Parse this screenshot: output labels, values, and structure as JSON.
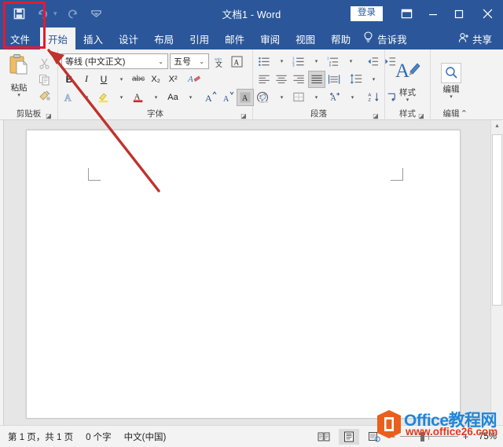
{
  "titlebar": {
    "quick_access": [
      {
        "name": "save-icon",
        "label": "保存"
      },
      {
        "name": "undo-icon",
        "label": "撤消"
      },
      {
        "name": "redo-icon",
        "label": "恢复"
      },
      {
        "name": "customize-qat-icon",
        "label": "自定义快速访问工具栏"
      }
    ],
    "document_title": "文档1  -  Word",
    "signin_label": "登录",
    "ribbon_display_label": "功能区显示选项",
    "minimize_label": "最小化",
    "maximize_label": "最大化",
    "close_label": "关闭"
  },
  "tabs": [
    {
      "label": "文件",
      "active": false,
      "file": true
    },
    {
      "label": "开始",
      "active": true
    },
    {
      "label": "插入",
      "active": false
    },
    {
      "label": "设计",
      "active": false
    },
    {
      "label": "布局",
      "active": false
    },
    {
      "label": "引用",
      "active": false
    },
    {
      "label": "邮件",
      "active": false
    },
    {
      "label": "审阅",
      "active": false
    },
    {
      "label": "视图",
      "active": false
    },
    {
      "label": "帮助",
      "active": false
    }
  ],
  "tell_me": {
    "label": "告诉我",
    "icon": "lightbulb-icon"
  },
  "share": {
    "label": "共享",
    "icon": "share-person-icon"
  },
  "ribbon": {
    "clipboard": {
      "group_label": "剪贴板",
      "paste_label": "粘贴",
      "copy_label": "复制",
      "format_painter_label": "格式刷"
    },
    "font": {
      "group_label": "字体",
      "font_name": "等线 (中文正文)",
      "font_size": "五号",
      "bold": "B",
      "italic": "I",
      "underline": "U",
      "strikethrough": "abc",
      "subscript": "X₂",
      "superscript": "X²",
      "text_effects_label": "文本效果和版式",
      "highlight_label": "以不同颜色突出显示文本",
      "font_color_label": "字体颜色",
      "change_case": "Aa",
      "grow_font": "A",
      "shrink_font": "A",
      "phonetic_label": "拼音指南",
      "char_border_label": "字符边框",
      "char_shading_label": "字符底纹"
    },
    "paragraph": {
      "group_label": "段落",
      "bullets_label": "项目符号",
      "numbering_label": "编号",
      "multilevel_label": "多级列表",
      "decrease_indent_label": "减少缩进量",
      "increase_indent_label": "增加缩进量",
      "align_left_label": "左对齐",
      "align_center_label": "居中",
      "align_right_label": "右对齐",
      "justify_label": "两端对齐",
      "distribute_label": "分散对齐",
      "line_spacing_label": "行和段落间距",
      "shading_label": "底纹",
      "borders_label": "边框",
      "sort_label": "排序",
      "show_marks_label": "显示/隐藏编辑标记"
    },
    "styles": {
      "group_label": "样式",
      "button_label": "样式"
    },
    "editing": {
      "group_label": "编辑",
      "button_label": "编辑"
    },
    "collapse_label": "折叠功能区"
  },
  "document": {
    "page_label": "文档页面",
    "margin_marks": 2
  },
  "scrollbar": {
    "up_label": "向上滚动",
    "thumb_label": "垂直滚动条"
  },
  "statusbar": {
    "page_info": "第 1 页，共 1 页",
    "word_count": "0 个字",
    "language": "中文(中国)",
    "views": [
      {
        "name": "read-mode-view-button",
        "label": "阅读视图",
        "active": false
      },
      {
        "name": "print-layout-view-button",
        "label": "页面视图",
        "active": true
      },
      {
        "name": "web-layout-view-button",
        "label": "Web 版式视图",
        "active": false
      }
    ],
    "zoom_out": "−",
    "zoom_in": "+",
    "zoom_level": "75%"
  },
  "annotations": {
    "highlight_color": "#e8192c",
    "highlight_target": "文件",
    "arrow_color": "#c0322b"
  },
  "watermark": {
    "brand": "Office教程网",
    "url": "www.office26.com",
    "logo_color": "#e8601c",
    "brand_color": "#1f86d8",
    "url_color": "#e03a1e"
  }
}
